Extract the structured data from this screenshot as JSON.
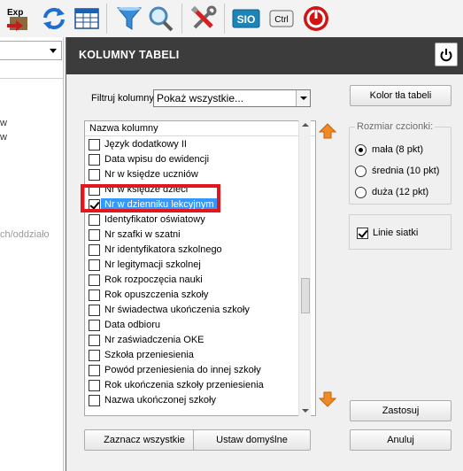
{
  "toolbar": {
    "buttons": [
      {
        "name": "export-icon",
        "label": "Exp"
      },
      {
        "name": "refresh-icon"
      },
      {
        "name": "table-icon"
      },
      {
        "name": "filter-icon"
      },
      {
        "name": "search-icon"
      },
      {
        "name": "tools-icon"
      },
      {
        "name": "sio-icon",
        "label": "SIO"
      },
      {
        "name": "ctrl-icon",
        "label": "Ctrl"
      },
      {
        "name": "power-icon"
      }
    ]
  },
  "background": {
    "line1": "w",
    "line2": "w",
    "path_fragment": "ch/oddziało"
  },
  "dialog": {
    "title": "KOLUMNY TABELI",
    "filter_label": "Filtruj kolumny:",
    "filter_value": "Pokaż wszystkie...",
    "bg_color_button": "Kolor tła tabeli",
    "font_size_group": "Rozmiar czcionki:",
    "font_sizes": [
      {
        "label": "mała   (8 pkt)",
        "selected": true
      },
      {
        "label": "średnia (10 pkt)",
        "selected": false
      },
      {
        "label": "duża (12 pkt)",
        "selected": false
      }
    ],
    "gridlines_label": "Linie siatki",
    "gridlines_checked": true,
    "list_header": "Nazwa kolumny",
    "columns": [
      {
        "label": "Język dodatkowy II",
        "checked": false
      },
      {
        "label": "Data wpisu do ewidencji",
        "checked": false
      },
      {
        "label": "Nr w księdze uczniów",
        "checked": false
      },
      {
        "label": "Nr w księdze dzieci",
        "checked": false
      },
      {
        "label": "Nr w dzienniku lekcyjnym",
        "checked": true,
        "selected": true
      },
      {
        "label": "Identyfikator oświatowy",
        "checked": false
      },
      {
        "label": "Nr szafki w szatni",
        "checked": false
      },
      {
        "label": "Nr identyfikatora szkolnego",
        "checked": false
      },
      {
        "label": "Nr legitymacji szkolnej",
        "checked": false
      },
      {
        "label": "Rok rozpoczęcia nauki",
        "checked": false
      },
      {
        "label": "Rok opuszczenia szkoły",
        "checked": false
      },
      {
        "label": "Nr świadectwa ukończenia szkoły",
        "checked": false
      },
      {
        "label": "Data odbioru",
        "checked": false
      },
      {
        "label": "Nr zaświadczenia OKE",
        "checked": false
      },
      {
        "label": "Szkoła przeniesienia",
        "checked": false
      },
      {
        "label": "Powód przeniesienia do innej szkoły",
        "checked": false
      },
      {
        "label": "Rok ukończenia szkoły przeniesienia",
        "checked": false
      },
      {
        "label": "Nazwa ukończonej szkoły",
        "checked": false
      }
    ],
    "select_all_button": "Zaznacz wszystkie",
    "defaults_button": "Ustaw domyślne",
    "apply_button": "Zastosuj",
    "cancel_button": "Anuluj"
  },
  "colors": {
    "title_bar": "#3c3c3c",
    "highlight": "#e3161c",
    "selection": "#3399ff",
    "arrow_orange": "#f08a24"
  }
}
